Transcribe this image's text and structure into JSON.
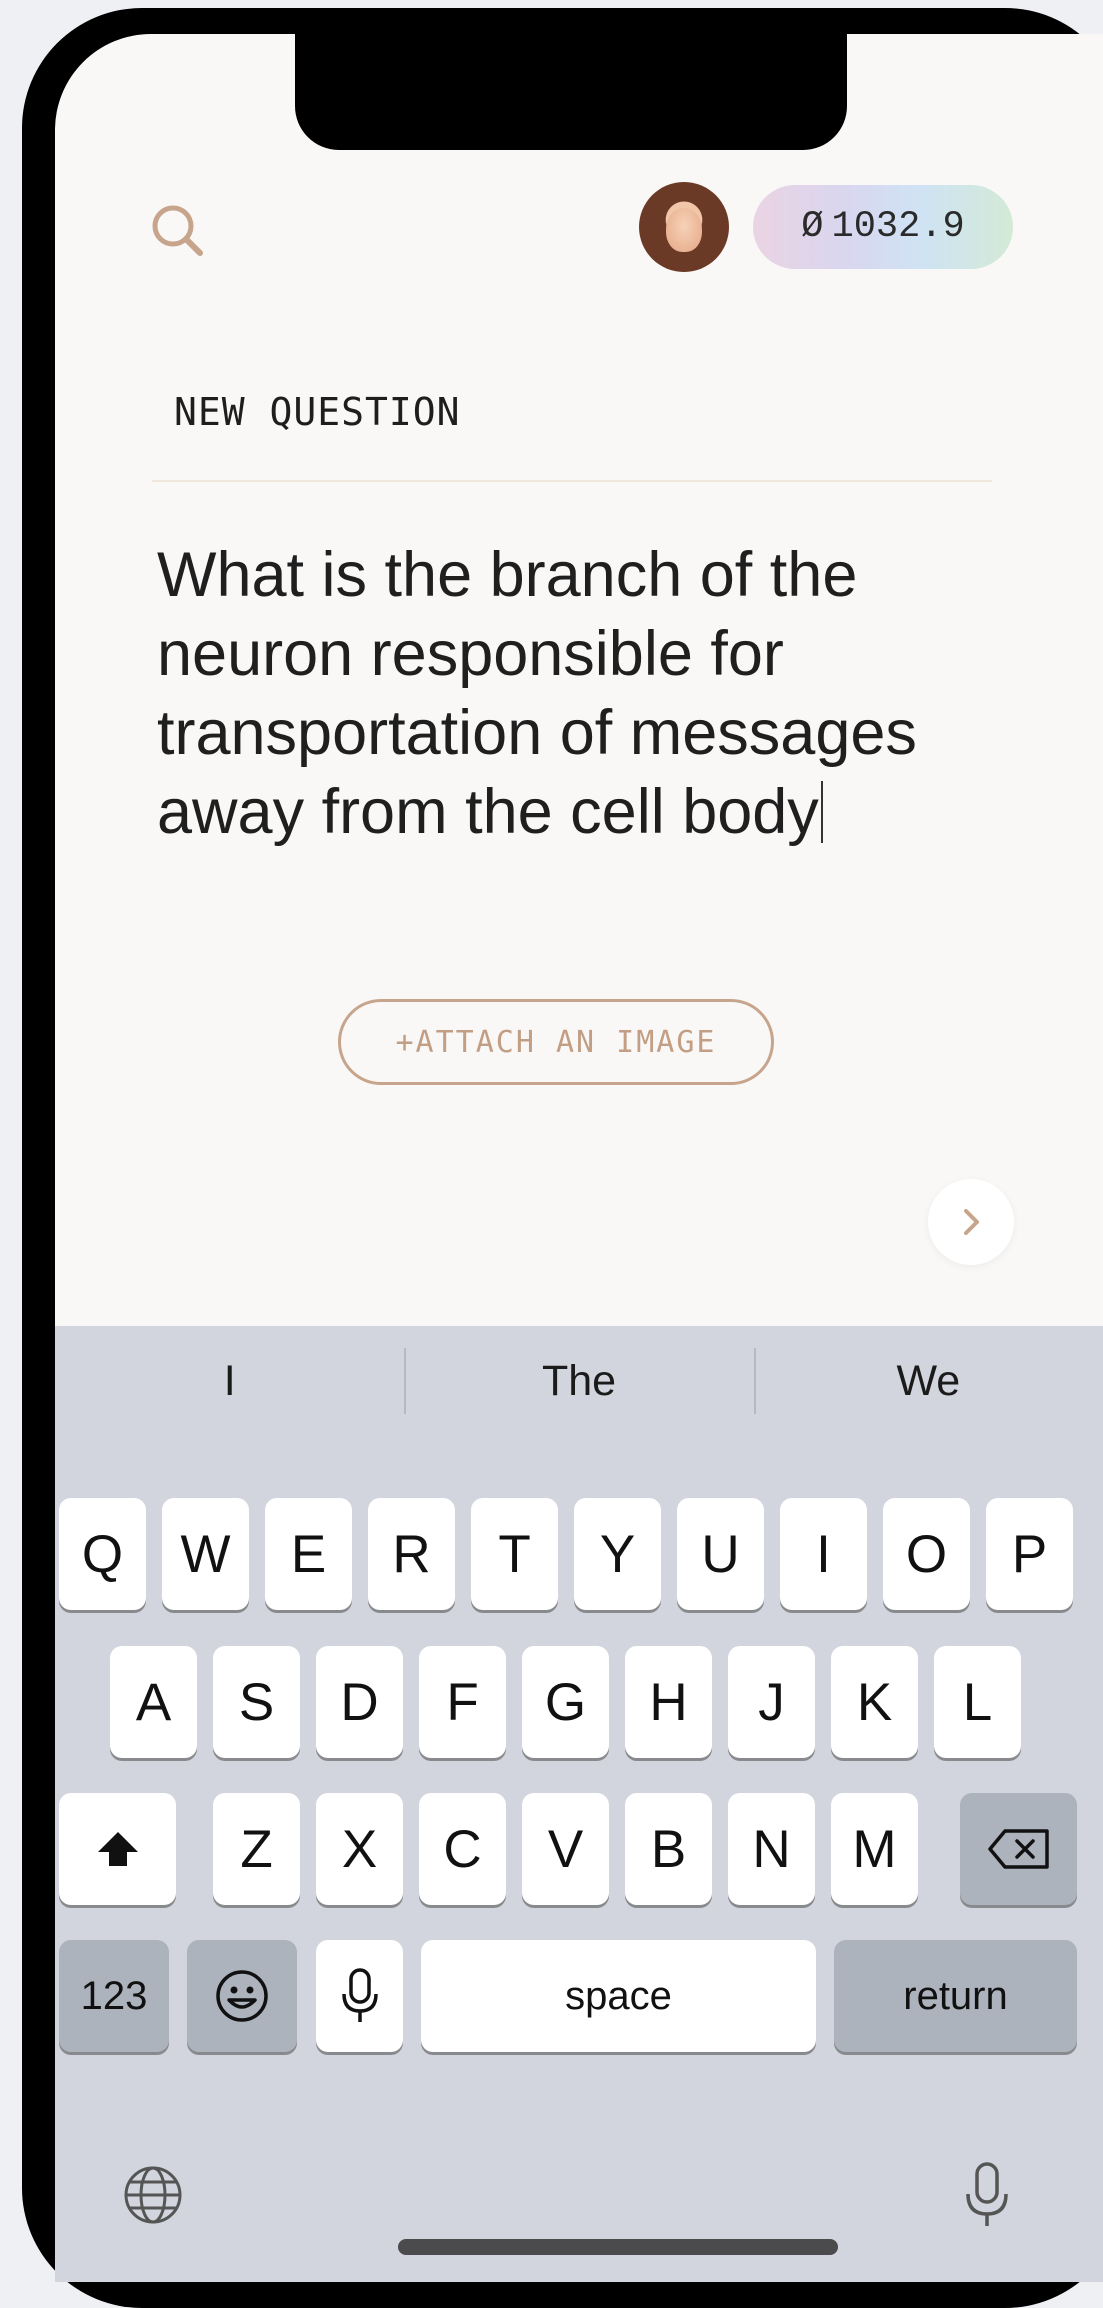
{
  "header": {
    "search_icon": "search-icon",
    "avatar_icon": "user-avatar",
    "balance_symbol": "Ø",
    "balance_value": "1032.9"
  },
  "composer": {
    "section_label": "NEW QUESTION",
    "question_text": "What is the branch of the neuron responsible for transportation of messages away from the cell body",
    "attach_label": "+ATTACH AN IMAGE",
    "next_icon": "chevron-right-icon"
  },
  "keyboard": {
    "suggestions": [
      "I",
      "The",
      "We"
    ],
    "row1": [
      "Q",
      "W",
      "E",
      "R",
      "T",
      "Y",
      "U",
      "I",
      "O",
      "P"
    ],
    "row2": [
      "A",
      "S",
      "D",
      "F",
      "G",
      "H",
      "J",
      "K",
      "L"
    ],
    "row3": [
      "Z",
      "X",
      "C",
      "V",
      "B",
      "N",
      "M"
    ],
    "numbers_label": "123",
    "space_label": "space",
    "return_label": "return",
    "icons": {
      "shift": "shift-icon",
      "backspace": "backspace-icon",
      "emoji": "emoji-icon",
      "dictation": "microphone-icon",
      "globe": "globe-icon"
    }
  },
  "colors": {
    "accent": "#c6a58c",
    "screen_background": "#faf8f6",
    "keyboard_background": "#d2d5dd"
  }
}
